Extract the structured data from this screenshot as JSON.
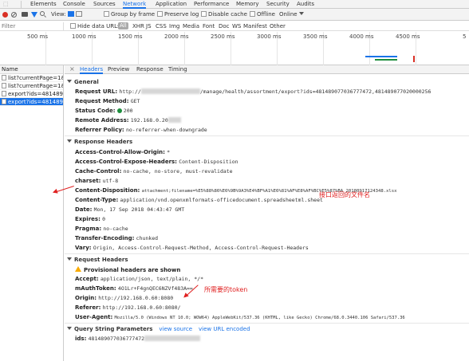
{
  "devtools_tabs": [
    "Elements",
    "Console",
    "Sources",
    "Network",
    "Application",
    "Performance",
    "Memory",
    "Security",
    "Audits"
  ],
  "active_tab": "Network",
  "toolbar": {
    "view_label": "View:",
    "group_by_frame": "Group by frame",
    "preserve_log": "Preserve log",
    "disable_cache": "Disable cache",
    "offline": "Offline",
    "throttle": "Online"
  },
  "filter": {
    "placeholder": "Filter",
    "hide_data_urls": "Hide data URLs",
    "types": [
      "All",
      "XHR",
      "JS",
      "CSS",
      "Img",
      "Media",
      "Font",
      "Doc",
      "WS",
      "Manifest",
      "Other"
    ]
  },
  "timeline": {
    "ticks": [
      "500 ms",
      "1000 ms",
      "1500 ms",
      "2000 ms",
      "2500 ms",
      "3000 ms",
      "3500 ms",
      "4000 ms",
      "4500 ms",
      "5"
    ],
    "colors": {
      "blue": "#1a73e8",
      "green": "#1e8e3e",
      "red": "#d93025"
    }
  },
  "request_list": {
    "header": "Name",
    "rows": [
      "list?currentPage=1&...",
      "list?currentPage=1&...",
      "export?ids=4814890...",
      "export?ids=4814890..."
    ],
    "selected_index": 3
  },
  "detail_tabs": [
    "Headers",
    "Preview",
    "Response",
    "Timing"
  ],
  "general": {
    "title": "General",
    "request_url_key": "Request URL:",
    "request_url_prefix": "http://",
    "request_url_suffix": "/manage/health/assortment/export?ids=481489077036777472,481489077020000256",
    "request_method_key": "Request Method:",
    "request_method": "GET",
    "status_code_key": "Status Code:",
    "status_code": "200",
    "remote_address_key": "Remote Address:",
    "remote_address": "192.168.0.20",
    "referrer_policy_key": "Referrer Policy:",
    "referrer_policy": "no-referrer-when-downgrade"
  },
  "response_headers": {
    "title": "Response Headers",
    "items": [
      {
        "k": "Access-Control-Allow-Origin:",
        "v": "*"
      },
      {
        "k": "Access-Control-Expose-Headers:",
        "v": "Content-Disposition"
      },
      {
        "k": "Cache-Control:",
        "v": "no-cache, no-store, must-revalidate"
      },
      {
        "k": "charset:",
        "v": "utf-8"
      },
      {
        "k": "Content-Disposition:",
        "v": "attachment;filename=%E5%88%86%E6%9B%9A3%E4%BF%A1%E6%81%AF%E8%AF%BC%E5%87%BA_20180917124348.xlsx"
      },
      {
        "k": "Content-Type:",
        "v": "application/vnd.openxmlformats-officedocument.spreadsheetml.sheet"
      },
      {
        "k": "Date:",
        "v": "Mon, 17 Sep 2018 04:43:47 GMT"
      },
      {
        "k": "Expires:",
        "v": "0"
      },
      {
        "k": "Pragma:",
        "v": "no-cache"
      },
      {
        "k": "Transfer-Encoding:",
        "v": "chunked"
      },
      {
        "k": "Vary:",
        "v": "Origin, Access-Control-Request-Method, Access-Control-Request-Headers"
      }
    ]
  },
  "request_headers": {
    "title": "Request Headers",
    "warning": "Provisional headers are shown",
    "items": [
      {
        "k": "Accept:",
        "v": "application/json, text/plain, */*"
      },
      {
        "k": "mAuthToken:",
        "v": "4O1Lr+F4gnQEC6NZVf483A=="
      },
      {
        "k": "Origin:",
        "v": "http://192.168.0.60:8080"
      },
      {
        "k": "Referer:",
        "v": "http://192.168.0.60:8080/"
      },
      {
        "k": "User-Agent:",
        "v": "Mozilla/5.0 (Windows NT 10.0; WOW64) AppleWebKit/537.36 (KHTML, like Gecko) Chrome/68.0.3440.106 Safari/537.36"
      }
    ]
  },
  "query_string": {
    "title": "Query String Parameters",
    "view_source": "view source",
    "view_url_encoded": "view URL encoded",
    "ids_key": "ids:",
    "ids_value": "481489077036777472"
  },
  "annotations": {
    "filename_note": "接口返回的文件名",
    "token_note": "所需要的token",
    "color": "#e02020"
  }
}
